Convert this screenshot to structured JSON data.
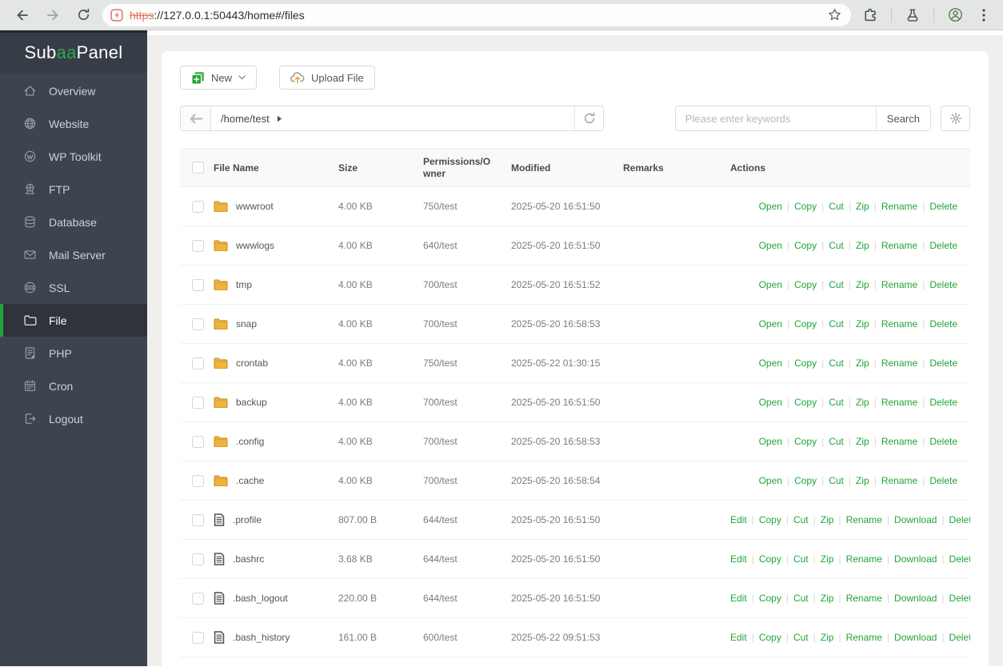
{
  "colors": {
    "accent_green": "#20a53a",
    "insecure_orange": "#e0745c",
    "folder_yellow": "#f0b43c"
  },
  "browser": {
    "url_scheme": "https",
    "url_rest": "://127.0.0.1:50443/home#/files"
  },
  "sidebar": {
    "logo": {
      "prefix": "Sub ",
      "highlight": "aa",
      "suffix": "Panel"
    },
    "items": [
      {
        "id": "overview",
        "icon": "home",
        "label": "Overview",
        "active": false
      },
      {
        "id": "website",
        "icon": "globe",
        "label": "Website",
        "active": false
      },
      {
        "id": "wp-toolkit",
        "icon": "wordpress",
        "label": "WP Toolkit",
        "active": false
      },
      {
        "id": "ftp",
        "icon": "ftp",
        "label": "FTP",
        "active": false
      },
      {
        "id": "database",
        "icon": "database",
        "label": "Database",
        "active": false
      },
      {
        "id": "mail-server",
        "icon": "mail",
        "label": "Mail Server",
        "active": false
      },
      {
        "id": "ssl",
        "icon": "ssl",
        "label": "SSL",
        "active": false
      },
      {
        "id": "file",
        "icon": "folder",
        "label": "File",
        "active": true
      },
      {
        "id": "php",
        "icon": "php",
        "label": "PHP",
        "active": false
      },
      {
        "id": "cron",
        "icon": "cron",
        "label": "Cron",
        "active": false
      },
      {
        "id": "logout",
        "icon": "logout",
        "label": "Logout",
        "active": false
      }
    ]
  },
  "toolbar": {
    "new_label": "New",
    "upload_label": "Upload File"
  },
  "pathbar": {
    "path": "/home/test"
  },
  "search": {
    "placeholder": "Please enter keywords",
    "button_label": "Search"
  },
  "table": {
    "columns": [
      "File Name",
      "Size",
      "Permissions/Owner",
      "Modified",
      "Remarks",
      "Actions"
    ],
    "rows": [
      {
        "name": "wwwroot",
        "type": "folder",
        "size": "4.00 KB",
        "permissions": "750/test",
        "modified": "2025-05-20 16:51:50",
        "remarks": "",
        "actions": [
          "Open",
          "Copy",
          "Cut",
          "Zip",
          "Rename",
          "Delete"
        ]
      },
      {
        "name": "wwwlogs",
        "type": "folder",
        "size": "4.00 KB",
        "permissions": "640/test",
        "modified": "2025-05-20 16:51:50",
        "remarks": "",
        "actions": [
          "Open",
          "Copy",
          "Cut",
          "Zip",
          "Rename",
          "Delete"
        ]
      },
      {
        "name": "tmp",
        "type": "folder",
        "size": "4.00 KB",
        "permissions": "700/test",
        "modified": "2025-05-20 16:51:52",
        "remarks": "",
        "actions": [
          "Open",
          "Copy",
          "Cut",
          "Zip",
          "Rename",
          "Delete"
        ]
      },
      {
        "name": "snap",
        "type": "folder",
        "size": "4.00 KB",
        "permissions": "700/test",
        "modified": "2025-05-20 16:58:53",
        "remarks": "",
        "actions": [
          "Open",
          "Copy",
          "Cut",
          "Zip",
          "Rename",
          "Delete"
        ]
      },
      {
        "name": "crontab",
        "type": "folder",
        "size": "4.00 KB",
        "permissions": "750/test",
        "modified": "2025-05-22 01:30:15",
        "remarks": "",
        "actions": [
          "Open",
          "Copy",
          "Cut",
          "Zip",
          "Rename",
          "Delete"
        ]
      },
      {
        "name": "backup",
        "type": "folder",
        "size": "4.00 KB",
        "permissions": "700/test",
        "modified": "2025-05-20 16:51:50",
        "remarks": "",
        "actions": [
          "Open",
          "Copy",
          "Cut",
          "Zip",
          "Rename",
          "Delete"
        ]
      },
      {
        "name": ".config",
        "type": "folder",
        "size": "4.00 KB",
        "permissions": "700/test",
        "modified": "2025-05-20 16:58:53",
        "remarks": "",
        "actions": [
          "Open",
          "Copy",
          "Cut",
          "Zip",
          "Rename",
          "Delete"
        ]
      },
      {
        "name": ".cache",
        "type": "folder",
        "size": "4.00 KB",
        "permissions": "700/test",
        "modified": "2025-05-20 16:58:54",
        "remarks": "",
        "actions": [
          "Open",
          "Copy",
          "Cut",
          "Zip",
          "Rename",
          "Delete"
        ]
      },
      {
        "name": ".profile",
        "type": "file",
        "size": "807.00 B",
        "permissions": "644/test",
        "modified": "2025-05-20 16:51:50",
        "remarks": "",
        "actions": [
          "Edit",
          "Copy",
          "Cut",
          "Zip",
          "Rename",
          "Download",
          "Delete"
        ]
      },
      {
        "name": ".bashrc",
        "type": "file",
        "size": "3.68 KB",
        "permissions": "644/test",
        "modified": "2025-05-20 16:51:50",
        "remarks": "",
        "actions": [
          "Edit",
          "Copy",
          "Cut",
          "Zip",
          "Rename",
          "Download",
          "Delete"
        ]
      },
      {
        "name": ".bash_logout",
        "type": "file",
        "size": "220.00 B",
        "permissions": "644/test",
        "modified": "2025-05-20 16:51:50",
        "remarks": "",
        "actions": [
          "Edit",
          "Copy",
          "Cut",
          "Zip",
          "Rename",
          "Download",
          "Delete"
        ]
      },
      {
        "name": ".bash_history",
        "type": "file",
        "size": "161.00 B",
        "permissions": "600/test",
        "modified": "2025-05-22 09:51:53",
        "remarks": "",
        "actions": [
          "Edit",
          "Copy",
          "Cut",
          "Zip",
          "Rename",
          "Download",
          "Delete"
        ]
      }
    ]
  }
}
